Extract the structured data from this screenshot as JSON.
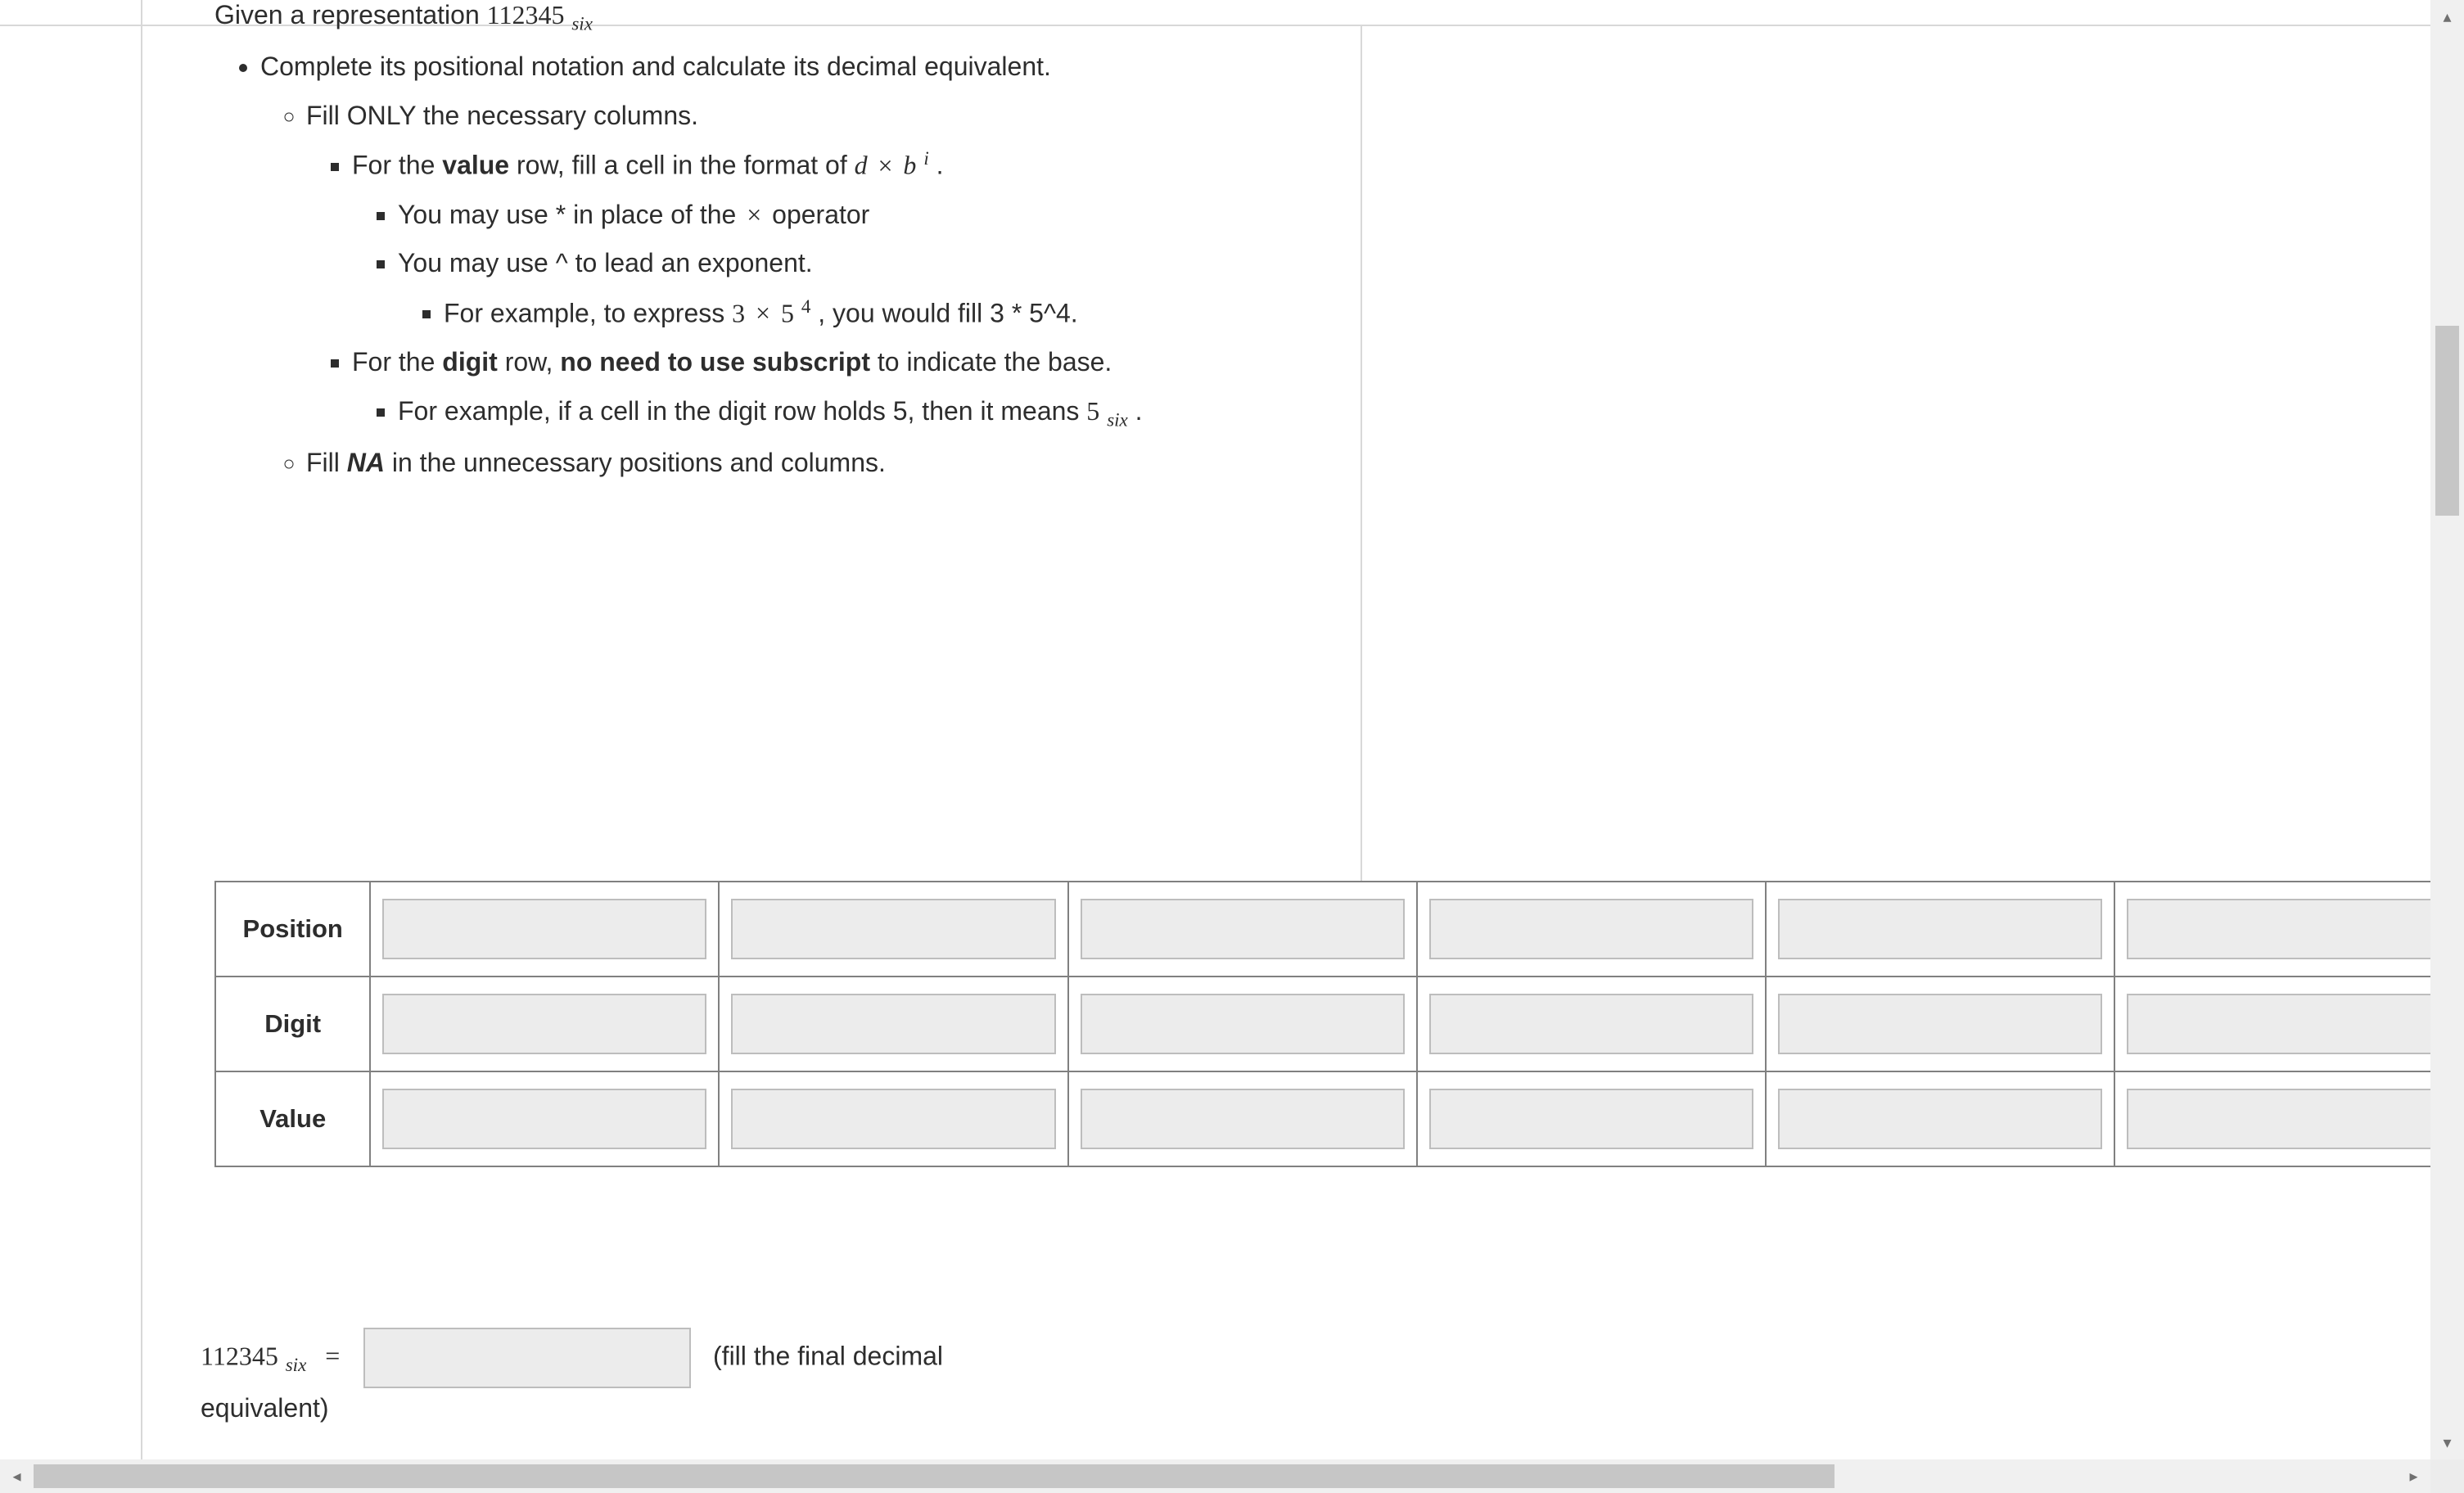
{
  "intro": {
    "prefix": "Given a representation ",
    "number": "112345",
    "baseword": "six"
  },
  "bullets": {
    "b1": "Complete its positional notation and calculate its decimal equivalent.",
    "b1a": "Fill ONLY the necessary columns.",
    "b1a1_pre": "For the ",
    "b1a1_bold": "value",
    "b1a1_mid": " row, fill a cell in the format of ",
    "b1a1_math_d": "d",
    "b1a1_math_b": "b",
    "b1a1_math_i": "i",
    "b1a1_post": ".",
    "b1a1i_pre": "You may use * in place of the ",
    "b1a1i_post": "operator",
    "b1a1ii": "You may use ^ to lead an exponent.",
    "b1a1iiA_pre": "For example, to express ",
    "b1a1iiA_m3": "3",
    "b1a1iiA_m5": "5",
    "b1a1iiA_m4": "4",
    "b1a1iiA_post": ", you would fill 3 * 5^4.",
    "b1a2_pre": "For the ",
    "b1a2_bold1": "digit",
    "b1a2_mid": " row, ",
    "b1a2_bold2": "no need to use subscript",
    "b1a2_post": " to indicate the base.",
    "b1a2i_pre": "For example, if a cell in the digit row holds 5, then it means ",
    "b1a2i_m5": "5",
    "b1a2i_base": "six",
    "b1a2i_post": ".",
    "b1b_pre": "Fill ",
    "b1b_bold": "NA",
    "b1b_post": " in the unnecessary positions and columns."
  },
  "table": {
    "rows": [
      "Position",
      "Digit",
      "Value"
    ]
  },
  "final": {
    "num": "112345",
    "base": "six",
    "eq": "=",
    "paren": "(fill the final decimal",
    "equiv": "equivalent)"
  }
}
